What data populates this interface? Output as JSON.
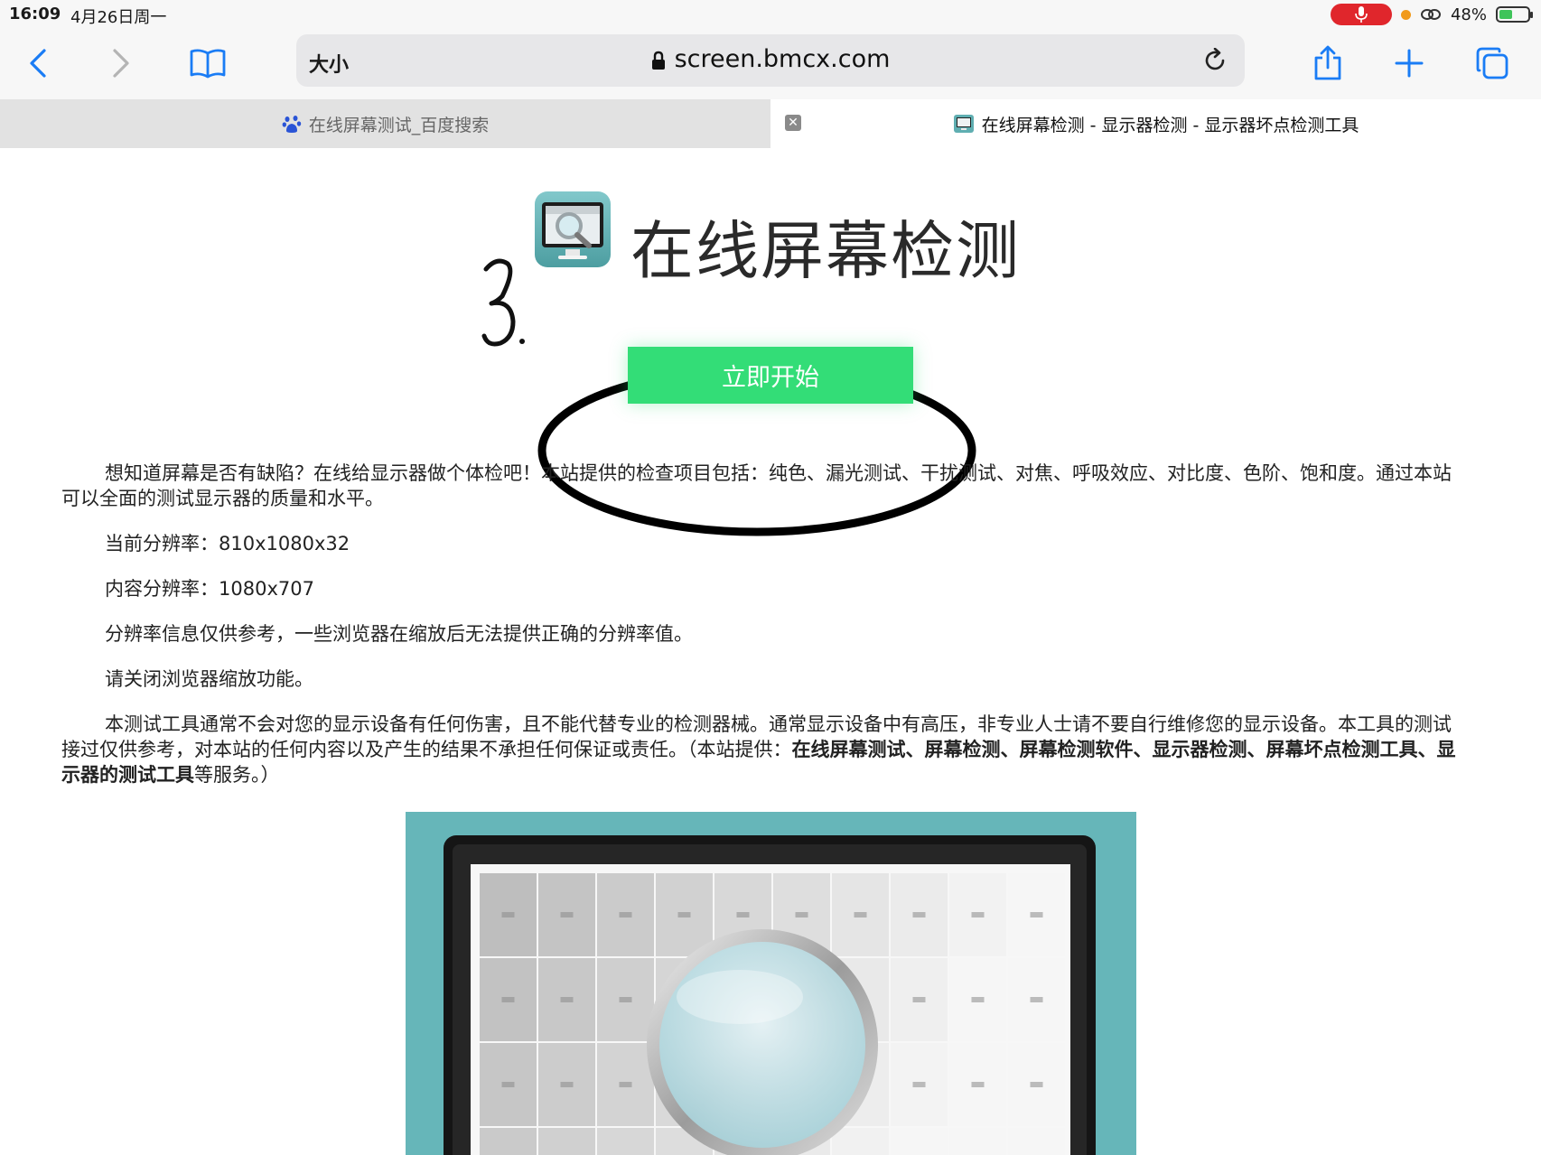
{
  "status_bar": {
    "time": "16:09",
    "date": "4月26日周一",
    "battery_percent": "48%",
    "battery_level": 0.48
  },
  "toolbar": {
    "text_size_label": "大小",
    "url": "screen.bmcx.com"
  },
  "tabs": [
    {
      "title": "在线屏幕测试_百度搜索"
    },
    {
      "title": "在线屏幕检测 - 显示器检测 - 显示器坏点检测工具"
    }
  ],
  "page": {
    "site_title": "在线屏幕检测",
    "annotation": "3.",
    "start_button": "立即开始",
    "intro": "想知道屏幕是否有缺陷？在线给显示器做个体检吧！本站提供的检查项目包括：纯色、漏光测试、干扰测试、对焦、呼吸效应、对比度、色阶、饱和度。通过本站可以全面的测试显示器的质量和水平。",
    "current_resolution_label": "当前分辨率：",
    "current_resolution": "810x1080x32",
    "content_resolution_label": "内容分辨率：",
    "content_resolution": "1080x707",
    "note1": "分辨率信息仅供参考，一些浏览器在缩放后无法提供正确的分辨率值。",
    "note2": "请关闭浏览器缩放功能。",
    "disclaimer": "本测试工具通常不会对您的显示设备有任何伤害，且不能代替专业的检测器械。通常显示设备中有高压，非专业人士请不要自行维修您的显示设备。本工具的测试接过仅供参考，对本站的任何内容以及产生的结果不承担任何保证或责任。（本站提供：",
    "services_bold": "在线屏幕测试、屏幕检测、屏幕检测软件、显示器检测、屏幕坏点检测工具、显示器的测试工具",
    "disclaimer_end": "等服务。）"
  },
  "colors": {
    "start_button": "#33dd77",
    "accent_blue": "#1a7cf5",
    "hero_bg": "#66b6b9"
  }
}
